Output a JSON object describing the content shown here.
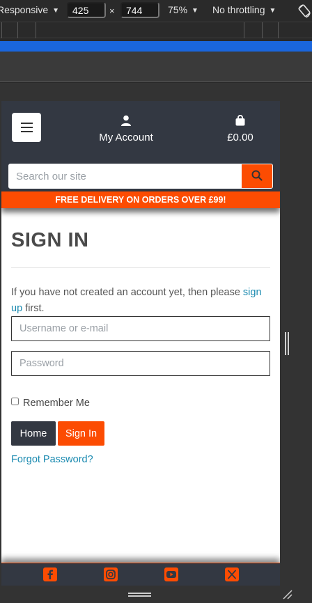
{
  "devtools": {
    "device_mode": "Responsive",
    "width": "425",
    "times": "×",
    "height": "744",
    "zoom": "75%",
    "throttling": "No throttling"
  },
  "header": {
    "account_label": "My Account",
    "bag_total": "£0.00"
  },
  "search": {
    "placeholder": "Search our site"
  },
  "promo_banner": "FREE DELIVERY ON ORDERS OVER £99!",
  "signin": {
    "title": "SIGN IN",
    "intro_before": "If you have not created an account yet, then please ",
    "intro_link": "sign up",
    "intro_after": " first.",
    "username_placeholder": "Username or e-mail",
    "password_placeholder": "Password",
    "remember_label": "Remember Me",
    "home_button": "Home",
    "signin_button": "Sign In",
    "forgot_link": "Forgot Password?"
  },
  "footer": {
    "social_icons": [
      "facebook-icon",
      "instagram-icon",
      "youtube-icon",
      "x-icon"
    ]
  },
  "colors": {
    "brand_orange": "#fc4c02",
    "header_dark": "#333842",
    "link_teal": "#1a8ab0"
  }
}
